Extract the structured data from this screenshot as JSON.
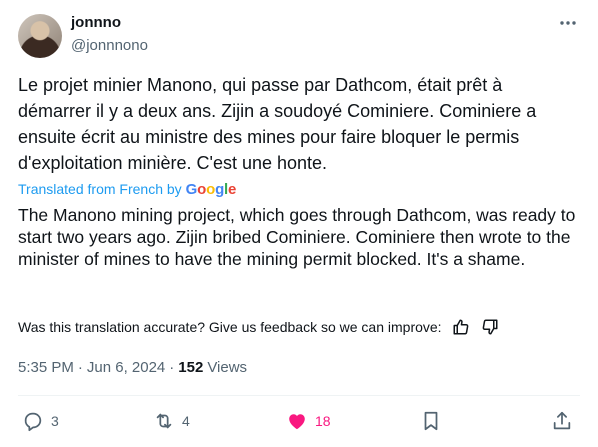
{
  "author": {
    "display_name": "jonnno",
    "handle": "@jonnnono"
  },
  "tweet": {
    "original_text": "Le projet minier Manono, qui passe par Dathcom, était prêt à démarrer il y a deux ans. Zijin a soudoyé Cominiere. Cominiere a ensuite écrit au ministre des mines pour faire bloquer le permis d'exploitation minière. C'est une honte.",
    "translated_from": "Translated from French by",
    "translation_provider": "Google",
    "translated_text": "The Manono mining project, which goes through Dathcom, was ready to start two years ago. Zijin bribed Cominiere. Cominiere then wrote to the minister of mines to have the mining permit blocked. It's a shame.",
    "feedback_prompt": "Was this translation accurate? Give us feedback so we can improve:",
    "time": "5:35 PM",
    "separator": "·",
    "date": "Jun 6, 2024",
    "views_count": "152",
    "views_label": "Views"
  },
  "actions": {
    "replies": "3",
    "reposts": "4",
    "likes": "18"
  },
  "colors": {
    "link_blue": "#1d9bf0",
    "like_pink": "#f91880",
    "muted": "#536471",
    "text": "#0f1419"
  },
  "icons": {
    "more": "more-icon",
    "thumbs_up": "thumbs-up-icon",
    "thumbs_down": "thumbs-down-icon",
    "reply": "reply-icon",
    "repost": "repost-icon",
    "like": "heart-icon",
    "bookmark": "bookmark-icon",
    "share": "share-icon"
  }
}
